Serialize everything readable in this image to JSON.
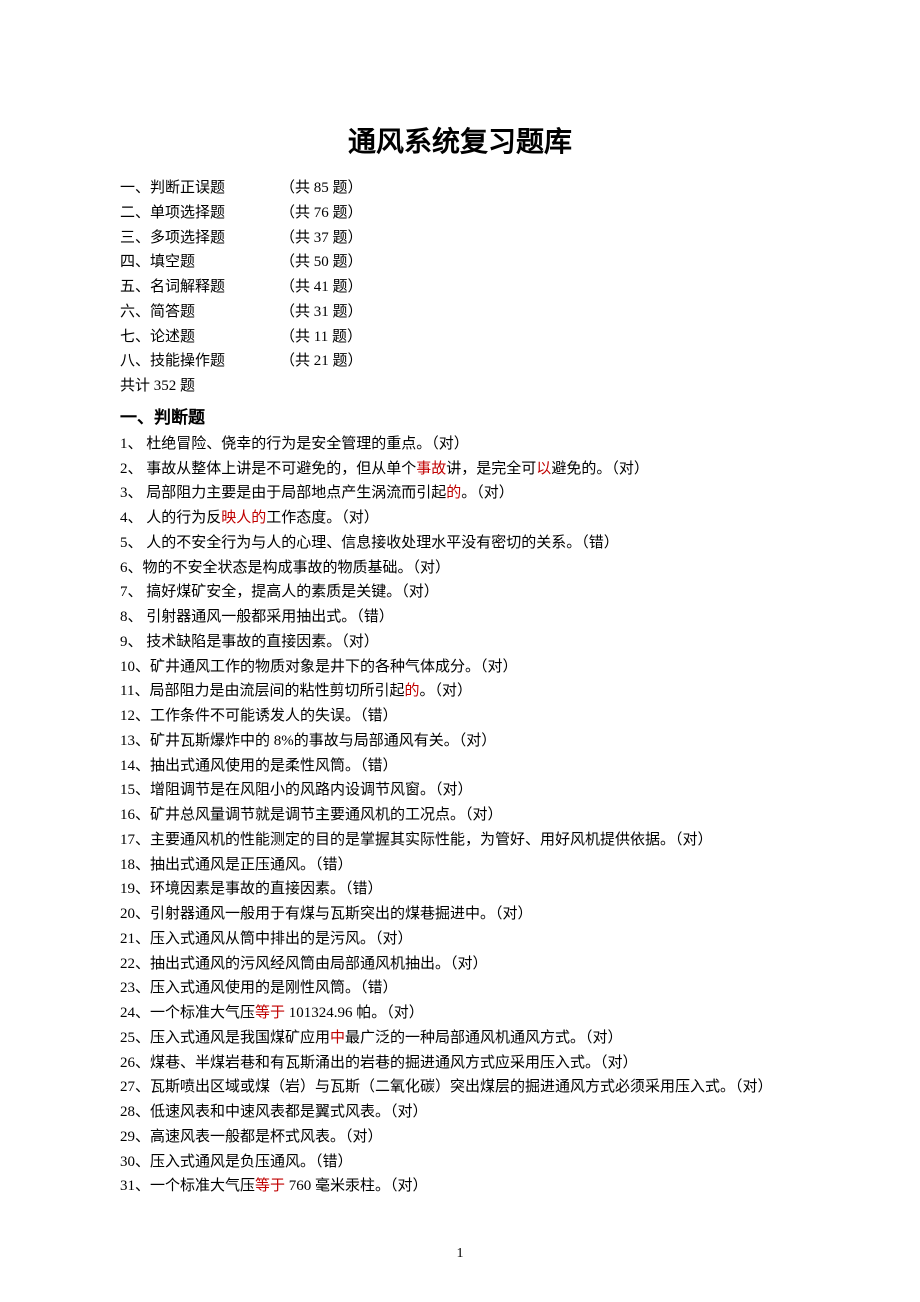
{
  "title": "通风系统复习题库",
  "toc": [
    {
      "label": "一、判断正误题",
      "count": "（共 85 题）"
    },
    {
      "label": "二、单项选择题",
      "count": "（共 76 题）"
    },
    {
      "label": "三、多项选择题",
      "count": "（共 37 题）"
    },
    {
      "label": "四、填空题",
      "count": "（共 50 题）"
    },
    {
      "label": "五、名词解释题",
      "count": "（共 41 题）"
    },
    {
      "label": "六、简答题",
      "count": "（共 31 题）"
    },
    {
      "label": "七、论述题",
      "count": "（共 11 题）"
    },
    {
      "label": "八、技能操作题",
      "count": "（共 21 题）"
    }
  ],
  "total": "共计 352 题",
  "section_heading": "一、判断题",
  "questions": [
    {
      "segments": [
        {
          "t": "1、 杜绝冒险、侥幸的行为是安全管理的重点。（对）"
        }
      ]
    },
    {
      "segments": [
        {
          "t": "2、 事故从整体上讲是不可避免的，但从单个"
        },
        {
          "t": "事故",
          "hl": true
        },
        {
          "t": "讲，是完全可"
        },
        {
          "t": "以",
          "hl": true
        },
        {
          "t": "避免的。（对）"
        }
      ]
    },
    {
      "segments": [
        {
          "t": "3、 局部阻力主要是由于局部地点产生涡流而引起"
        },
        {
          "t": "的",
          "hl": true
        },
        {
          "t": "。（对）"
        }
      ]
    },
    {
      "segments": [
        {
          "t": "4、 人的行为反"
        },
        {
          "t": "映人的",
          "hl": true
        },
        {
          "t": "工作态度。（对）"
        }
      ]
    },
    {
      "segments": [
        {
          "t": "5、 人的不安全行为与人的心理、信息接收处理水平没有密切的关系。（错）"
        }
      ]
    },
    {
      "segments": [
        {
          "t": "6、物的不安全状态是构成事故的物质基础。（对）"
        }
      ]
    },
    {
      "segments": [
        {
          "t": "7、 搞好煤矿安全，提高人的素质是关键。（对）"
        }
      ]
    },
    {
      "segments": [
        {
          "t": "8、 引射器通风一般都采用抽出式。（错）"
        }
      ]
    },
    {
      "segments": [
        {
          "t": "9、 技术缺陷是事故的直接因素。（对）"
        }
      ]
    },
    {
      "segments": [
        {
          "t": "10、矿井通风工作的物质对象是井下的各种气体成分。（对）"
        }
      ]
    },
    {
      "segments": [
        {
          "t": "11、局部阻力是由流层间的粘性剪切所引起"
        },
        {
          "t": "的",
          "hl": true
        },
        {
          "t": "。（对）"
        }
      ]
    },
    {
      "segments": [
        {
          "t": "12、工作条件不可能诱发人的失误。（错）"
        }
      ]
    },
    {
      "segments": [
        {
          "t": "13、矿井瓦斯爆炸中的 8%的事故与局部通风有关。（对）"
        }
      ]
    },
    {
      "segments": [
        {
          "t": "14、抽出式通风使用的是柔性风筒。（错）"
        }
      ]
    },
    {
      "segments": [
        {
          "t": "15、增阻调节是在风阻小的风路内设调节风窗。（对）"
        }
      ]
    },
    {
      "segments": [
        {
          "t": "16、矿井总风量调节就是调节主要通风机的工况点。（对）"
        }
      ]
    },
    {
      "segments": [
        {
          "t": "17、主要通风机的性能测定的目的是掌握其实际性能，为管好、用好风机提供依据。（对）"
        }
      ]
    },
    {
      "segments": [
        {
          "t": "18、抽出式通风是正压通风。（错）"
        }
      ]
    },
    {
      "segments": [
        {
          "t": "19、环境因素是事故的直接因素。（错）"
        }
      ]
    },
    {
      "segments": [
        {
          "t": "20、引射器通风一般用于有煤与瓦斯突出的煤巷掘进中。（对）"
        }
      ]
    },
    {
      "segments": [
        {
          "t": "21、压入式通风从筒中排出的是污风。（对）"
        }
      ]
    },
    {
      "segments": [
        {
          "t": "22、抽出式通风的污风经风筒由局部通风机抽出。（对）"
        }
      ]
    },
    {
      "segments": [
        {
          "t": "23、压入式通风使用的是刚性风筒。（错）"
        }
      ]
    },
    {
      "segments": [
        {
          "t": "24、一个标准大气压"
        },
        {
          "t": "等于",
          "hl": true
        },
        {
          "t": " 101324.96 帕。（对）"
        }
      ]
    },
    {
      "segments": [
        {
          "t": "25、压入式通风是我国煤矿应用"
        },
        {
          "t": "中",
          "hl": true
        },
        {
          "t": "最广泛的一种局部通风机通风方式。（对）"
        }
      ]
    },
    {
      "segments": [
        {
          "t": "26、煤巷、半煤岩巷和有瓦斯涌出的岩巷的掘进通风方式应采用压入式。（对）"
        }
      ]
    },
    {
      "segments": [
        {
          "t": "27、瓦斯喷出区域或煤（岩）与瓦斯（二氧化碳）突出煤层的掘进通风方式必须采用压入式。（对）"
        }
      ]
    },
    {
      "segments": [
        {
          "t": "28、低速风表和中速风表都是翼式风表。（对）"
        }
      ]
    },
    {
      "segments": [
        {
          "t": "29、高速风表一般都是杯式风表。（对）"
        }
      ]
    },
    {
      "segments": [
        {
          "t": "30、压入式通风是负压通风。（错）"
        }
      ]
    },
    {
      "segments": [
        {
          "t": "31、一个标准大气压"
        },
        {
          "t": "等于",
          "hl": true
        },
        {
          "t": " 760 毫米汞柱。（对）"
        }
      ]
    }
  ],
  "page_number": "1"
}
